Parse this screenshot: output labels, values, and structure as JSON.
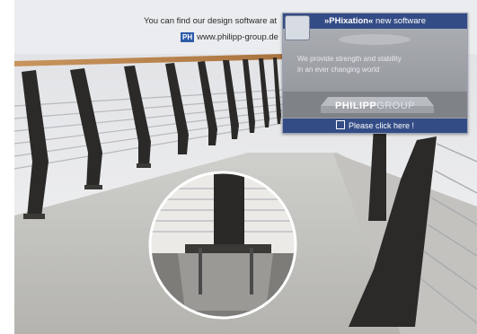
{
  "header": {
    "info_text": "You can find our design software at",
    "badge_text": "PH",
    "url_text": "www.philipp-group.de"
  },
  "popup": {
    "title_prefix": "»PHixation«",
    "title_suffix": " new software",
    "body_line1": "We provide strength and stability",
    "body_line2": "in an ever changing world",
    "logo_part1": "PHILIPP",
    "logo_part2": "GROUP",
    "cta_label": "Please click here !",
    "app_icon": "phixation-app-icon"
  },
  "colors": {
    "brand_blue": "#344c86",
    "badge_blue": "#2f5ba8",
    "header_band": "#ebecef"
  }
}
